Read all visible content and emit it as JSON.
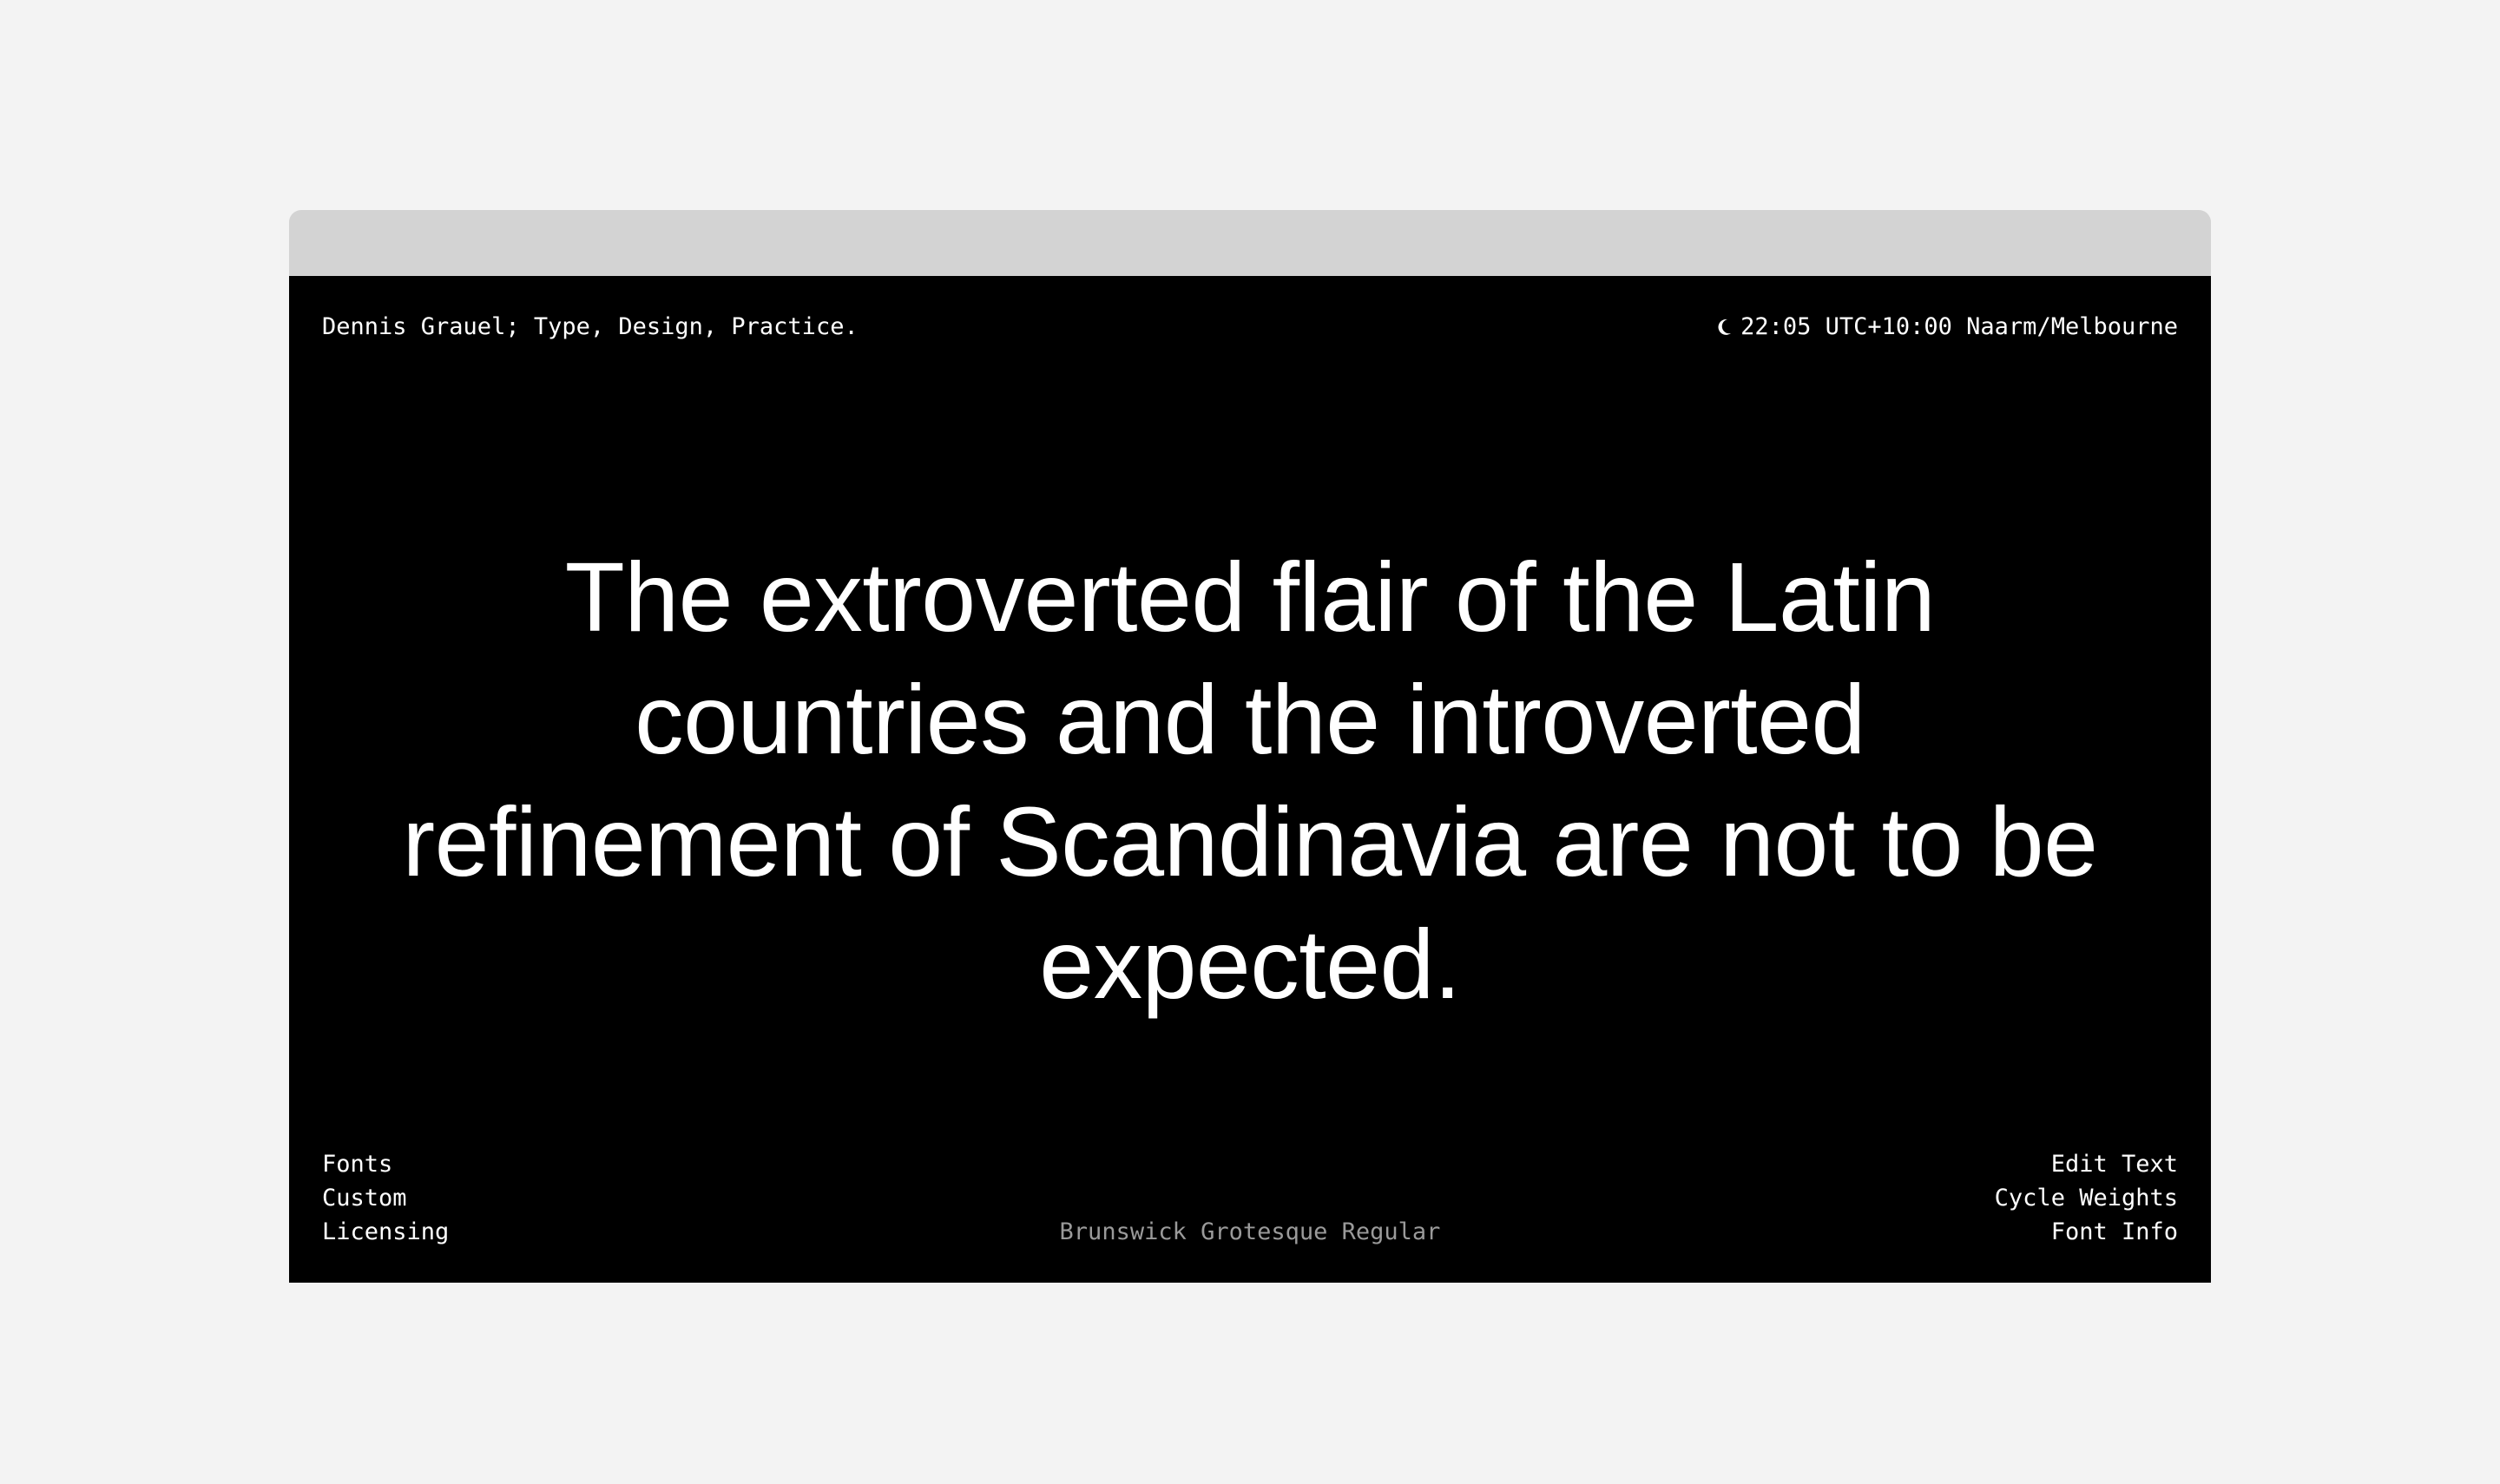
{
  "header": {
    "site_title": "Dennis Grauel; Type, Design, Practice.",
    "clock_icon": "moon-icon",
    "clock_text": "22:05 UTC+10:00 Naarm/Melbourne"
  },
  "main": {
    "headline": "The extroverted flair of the Latin countries and the introverted refinement of Scandinavia are not to be expected."
  },
  "footer": {
    "nav_left": [
      "Fonts",
      "Custom",
      "Licensing"
    ],
    "font_name": "Brunswick Grotesque Regular",
    "nav_right": [
      "Edit Text",
      "Cycle Weights",
      "Font Info"
    ]
  },
  "colors": {
    "page_background": "#f3f3f3",
    "titlebar": "#d3d3d3",
    "screen_background": "#000000",
    "text": "#ffffff",
    "muted_text": "#9a9a9a"
  }
}
